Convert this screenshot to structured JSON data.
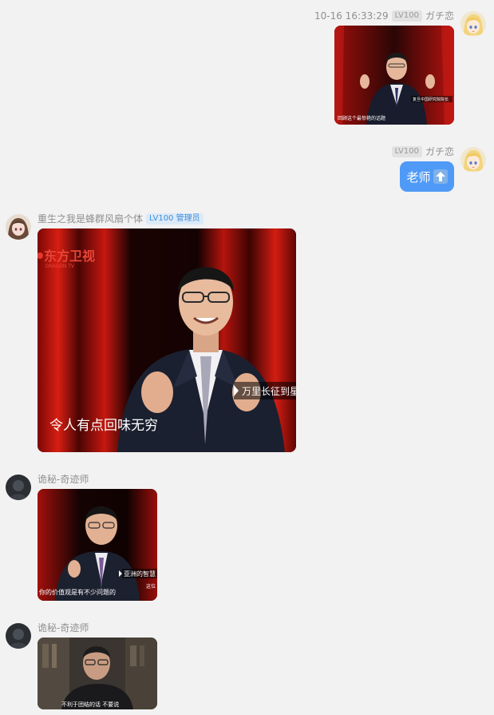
{
  "messages": [
    {
      "side": "right",
      "timestamp": "10-16 16:33:29",
      "level": "LV100",
      "username": "ガチ恋",
      "type": "image",
      "caption": "回顾这个最惊艳的话题",
      "ticker": "复旦中国研究院院长"
    },
    {
      "side": "right",
      "level": "LV100",
      "username": "ガチ恋",
      "type": "text",
      "text": "老师",
      "emoji": "up-arrow"
    },
    {
      "side": "left",
      "username": "重生之我是蜂群风扇个体",
      "level": "LV100",
      "role": "管理员",
      "type": "image",
      "logo": "东方卫视",
      "logo_sub": "DRAGON TV",
      "caption": "令人有点回味无穷",
      "ticker": "万里长征到星"
    },
    {
      "side": "left",
      "username": "诡秘-奇迹师",
      "type": "image",
      "caption": "你的价值观是有不少问题的",
      "ticker": "亚洲的智慧",
      "ticker2": "这位"
    },
    {
      "side": "left",
      "username": "诡秘-奇迹师",
      "type": "image",
      "caption": "不利于团结的话 不要说"
    }
  ],
  "colors": {
    "background": "#f2f2f2",
    "bubble": "#4f9af7",
    "admin_badge": "#3f8ed8"
  }
}
